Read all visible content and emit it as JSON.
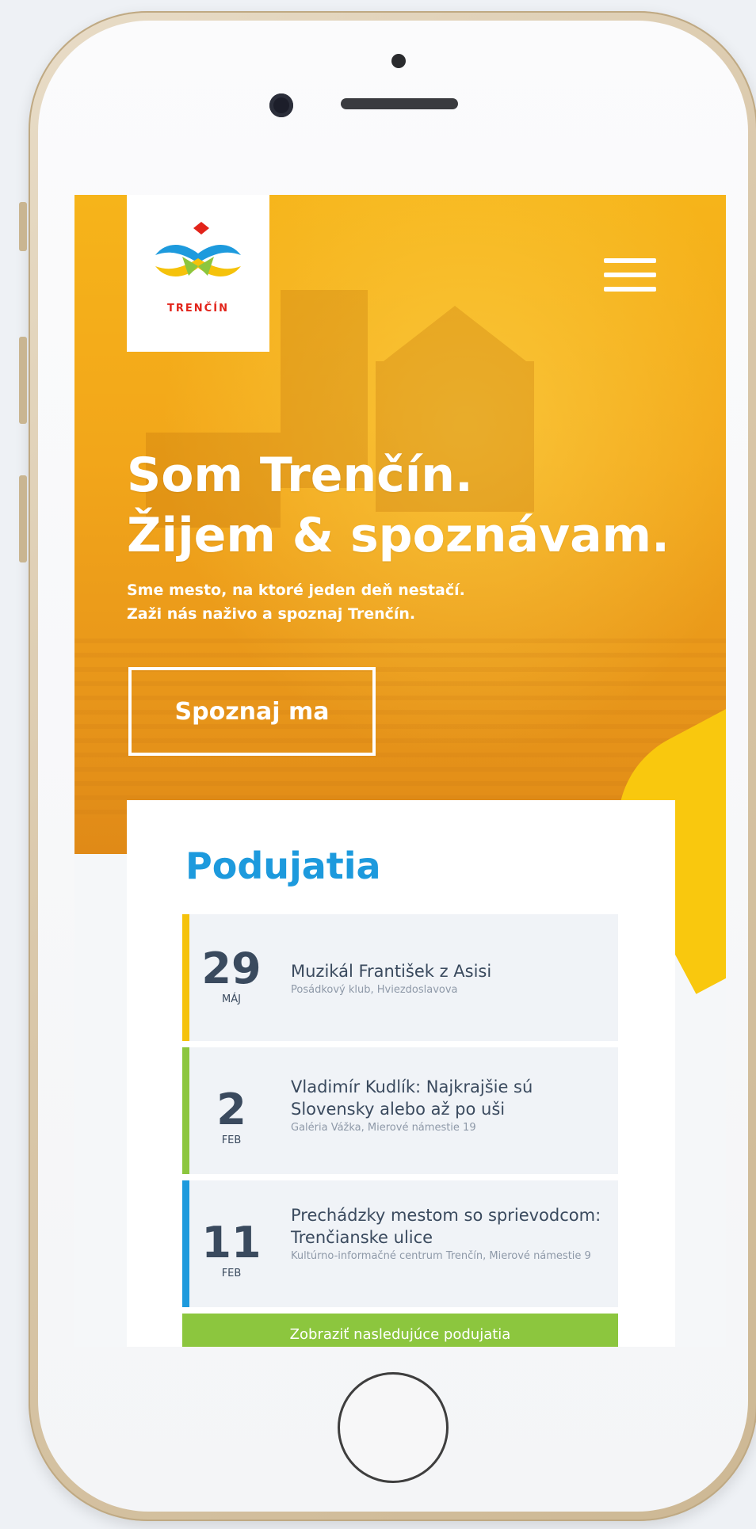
{
  "brand": {
    "logo_text": "TRENČÍN",
    "colors": {
      "hero_yellow": "#f2a61a",
      "title_blue": "#1d9add",
      "accent_green": "#8cc63e",
      "accent_yellow": "#f5c20b",
      "logo_red": "#e2231a"
    }
  },
  "header": {
    "menu_icon": "hamburger-menu-icon"
  },
  "hero": {
    "title_line1": "Som Trenčín.",
    "title_line2": "Žijem & spoznávam.",
    "subtitle_line1": "Sme mesto, na ktoré jeden deň nestačí.",
    "subtitle_line2": "Zaži nás naživo a spoznaj Trenčín.",
    "cta_label": "Spoznaj ma"
  },
  "events": {
    "title": "Podujatia",
    "items": [
      {
        "day": "29",
        "month": "MÁJ",
        "name": "Muzikál František z Asisi",
        "place": "Posádkový klub, Hviezdoslavova",
        "accent": "#f5c20b"
      },
      {
        "day": "2",
        "month": "FEB",
        "name": "Vladimír Kudlík: Najkrajšie sú Slovensky alebo až po uši",
        "place": "Galéria Vážka, Mierové námestie 19",
        "accent": "#8cc63e"
      },
      {
        "day": "11",
        "month": "FEB",
        "name": "Prechádzky mestom so sprievodcom: Trenčianske ulice",
        "place": "Kultúrno-informačné centrum Trenčín, Mierové námestie 9",
        "accent": "#1d9add"
      }
    ],
    "more_label": "Zobraziť nasledujúce podujatia"
  }
}
